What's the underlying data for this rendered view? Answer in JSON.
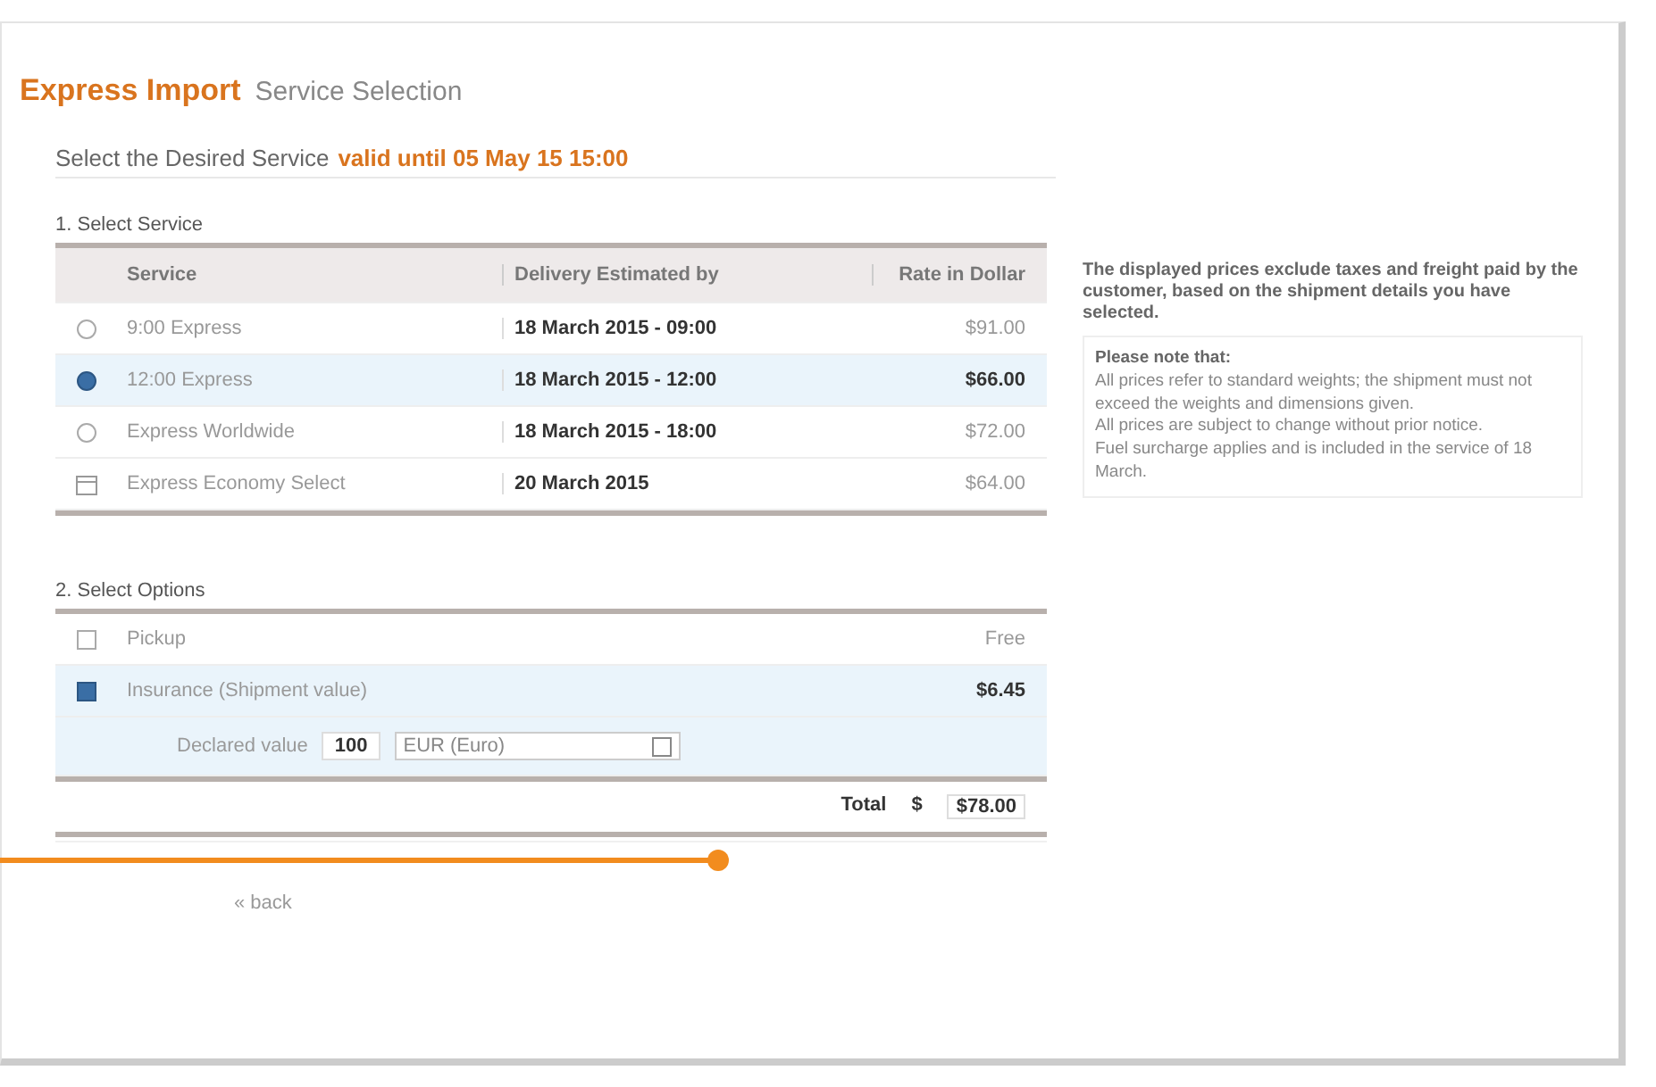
{
  "header": {
    "title": "Express Import",
    "subtitle": "Service Selection"
  },
  "instruction": {
    "text": "Select the Desired Service",
    "validity": "valid until 05 May 15 15:00"
  },
  "services": {
    "heading": "1. Select Service",
    "columns": [
      "Service",
      "Delivery Estimated by",
      "Rate in Dollar"
    ],
    "rows": [
      {
        "kind": "radio",
        "selected": false,
        "name": "9:00 Express",
        "delivery": "18 March 2015 - 09:00",
        "rate": "$91.00"
      },
      {
        "kind": "radio",
        "selected": true,
        "name": "12:00 Express",
        "delivery": "18 March 2015 - 12:00",
        "rate": "$66.00"
      },
      {
        "kind": "radio",
        "selected": false,
        "name": "Express Worldwide",
        "delivery": "18 March 2015 - 18:00",
        "rate": "$72.00"
      },
      {
        "kind": "calendar",
        "selected": false,
        "name": "Express Economy Select",
        "delivery": "20 March 2015",
        "rate": "$64.00"
      }
    ]
  },
  "note": {
    "intro": "The displayed prices exclude taxes and freight paid by the customer, based on the shipment details you have selected.",
    "heading": "Please note that:",
    "items": [
      "All prices refer to standard weights; the shipment must not exceed the weights and dimensions given.",
      "All prices are subject to change without prior notice.",
      "Fuel surcharge applies and is included in the service of 18 March."
    ]
  },
  "options": {
    "heading": "2. Select Options",
    "items": [
      {
        "checked": false,
        "name": "Pickup",
        "price": "Free"
      },
      {
        "checked": true,
        "name": "Insurance (Shipment value)",
        "price": "$6.45"
      }
    ],
    "declared": {
      "label": "Declared value",
      "value": "100",
      "currency": "EUR (Euro)"
    }
  },
  "total": {
    "label": "Total",
    "currency": "$",
    "amount": "$78.00"
  },
  "back_link": "« back"
}
